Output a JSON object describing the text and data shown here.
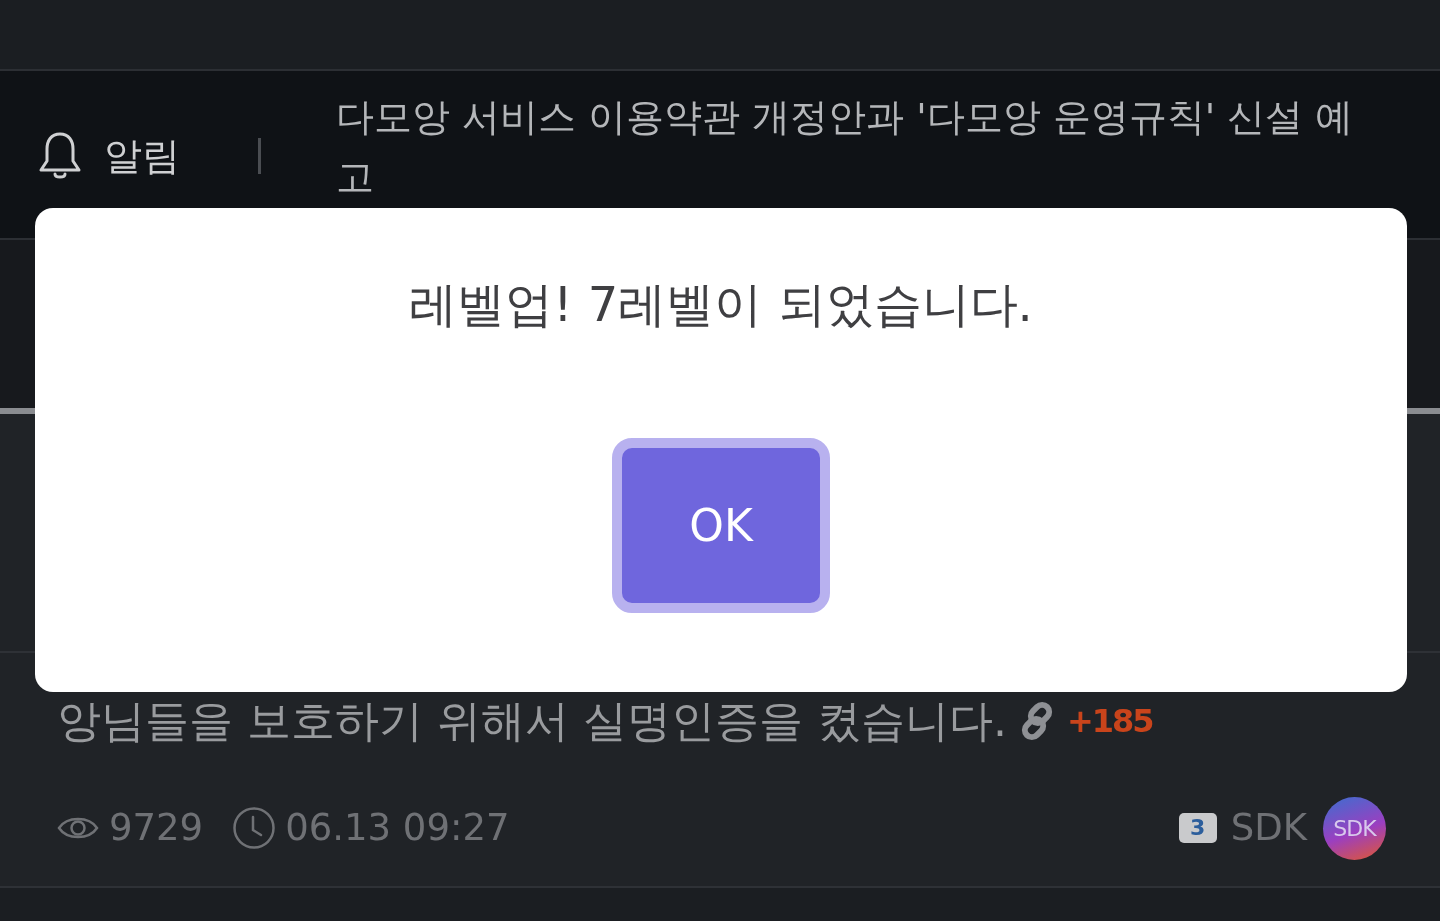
{
  "notice_bar": {
    "label": "알림",
    "text": "다모앙 서비스 이용약관 개정안과 '다모앙 운영규칙' 신설 예고"
  },
  "post": {
    "title": "앙님들을 보호하기 위해서 실명인증을 켰습니다.",
    "has_link": true,
    "points": "+185",
    "views": "9729",
    "time": "06.13 09:27",
    "author": {
      "level": "3",
      "name": "SDK",
      "avatar_text": "SDK"
    }
  },
  "dialog": {
    "message": "레벨업! 7레벨이 되었습니다.",
    "button": "OK"
  }
}
